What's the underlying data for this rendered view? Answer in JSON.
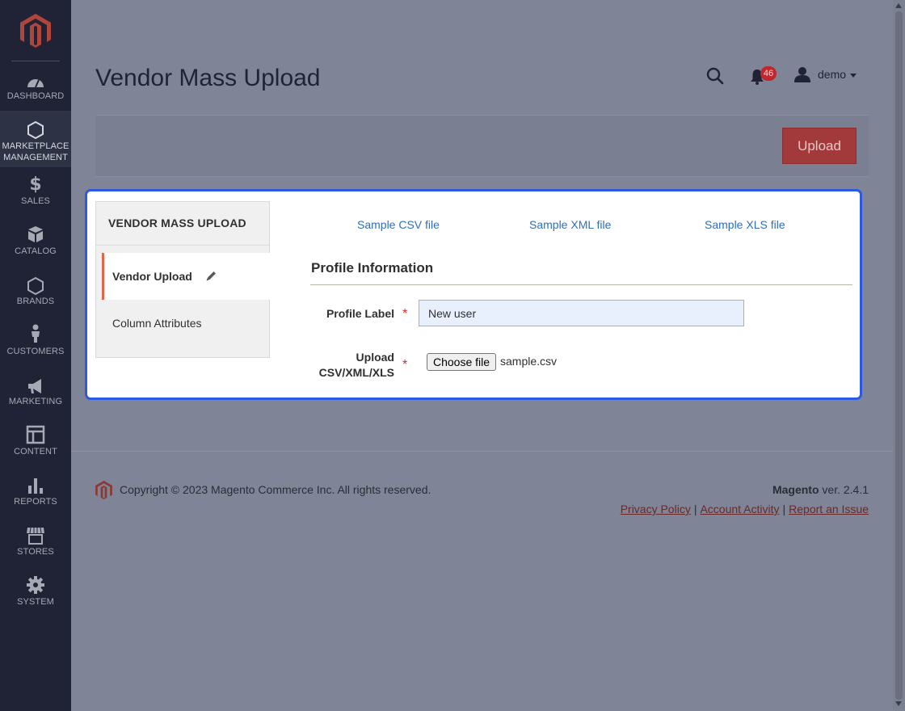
{
  "sidebar": {
    "logo": "magento-logo",
    "items": [
      {
        "label": "DASHBOARD",
        "icon": "dashboard-icon"
      },
      {
        "label": "MARKETPLACE MANAGEMENT",
        "label_line1": "MARKETPLACE",
        "label_line2": "MANAGEMENT",
        "icon": "hexagon-icon",
        "active": true
      },
      {
        "label": "SALES",
        "icon": "dollar-icon"
      },
      {
        "label": "CATALOG",
        "icon": "cube-icon"
      },
      {
        "label": "BRANDS",
        "icon": "hexagon-icon"
      },
      {
        "label": "CUSTOMERS",
        "icon": "person-icon"
      },
      {
        "label": "MARKETING",
        "icon": "megaphone-icon"
      },
      {
        "label": "CONTENT",
        "icon": "layout-icon"
      },
      {
        "label": "REPORTS",
        "icon": "bar-chart-icon"
      },
      {
        "label": "STORES",
        "icon": "store-icon"
      },
      {
        "label": "SYSTEM",
        "icon": "gear-icon"
      }
    ]
  },
  "header": {
    "page_title": "Vendor Mass Upload",
    "notification_count": "46",
    "user_name": "demo"
  },
  "action_bar": {
    "upload_label": "Upload"
  },
  "tabs": {
    "title": "VENDOR MASS UPLOAD",
    "items": [
      {
        "label": "Vendor Upload",
        "active": true
      },
      {
        "label": "Column Attributes",
        "active": false
      }
    ]
  },
  "samples": {
    "csv": "Sample CSV file",
    "xml": "Sample XML file",
    "xls": "Sample XLS file"
  },
  "form": {
    "section_title": "Profile Information",
    "profile_label": {
      "label": "Profile Label",
      "value": "New user",
      "required": "*"
    },
    "upload": {
      "label_line1": "Upload",
      "label_line2": "CSV/XML/XLS",
      "required": "*",
      "button_label": "Choose file",
      "file_name": "sample.csv"
    }
  },
  "footer": {
    "copyright": "Copyright © 2023 Magento Commerce Inc. All rights reserved.",
    "brand": "Magento",
    "version": "ver. 2.4.1",
    "links": [
      "Privacy Policy",
      "Account Activity",
      "Report an Issue"
    ],
    "separator": "|"
  },
  "colors": {
    "sidebar_bg": "#1f2335",
    "overlay_bg": "#7f8496",
    "modal_border": "#2b59e6",
    "accent": "#e0654a",
    "link": "#2f6fb8",
    "upload_button": "#a23a3c",
    "required": "#e22626"
  }
}
